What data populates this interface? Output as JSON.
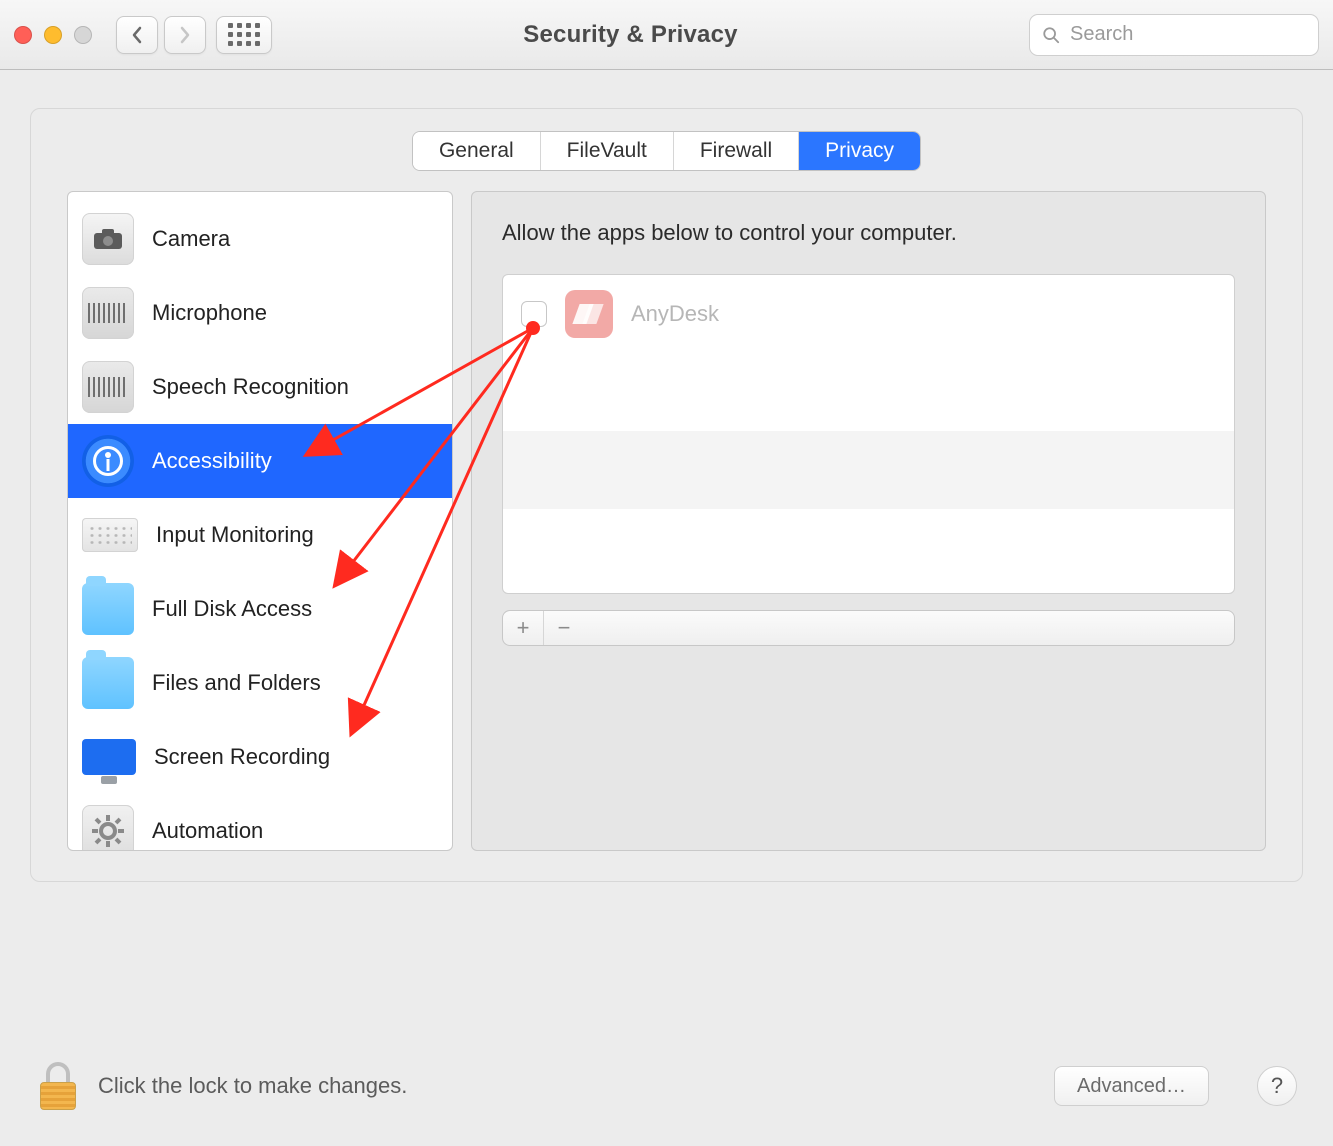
{
  "window": {
    "title": "Security & Privacy",
    "search_placeholder": "Search"
  },
  "tabs": [
    {
      "label": "General",
      "active": false
    },
    {
      "label": "FileVault",
      "active": false
    },
    {
      "label": "Firewall",
      "active": false
    },
    {
      "label": "Privacy",
      "active": true
    }
  ],
  "sidebar": {
    "items": [
      {
        "label": "Camera",
        "icon": "camera-icon"
      },
      {
        "label": "Microphone",
        "icon": "microphone-icon"
      },
      {
        "label": "Speech Recognition",
        "icon": "speech-icon"
      },
      {
        "label": "Accessibility",
        "icon": "accessibility-icon",
        "selected": true
      },
      {
        "label": "Input Monitoring",
        "icon": "keyboard-icon"
      },
      {
        "label": "Full Disk Access",
        "icon": "folder-icon"
      },
      {
        "label": "Files and Folders",
        "icon": "folder-icon"
      },
      {
        "label": "Screen Recording",
        "icon": "screen-icon"
      },
      {
        "label": "Automation",
        "icon": "gear-icon"
      }
    ]
  },
  "right": {
    "heading": "Allow the apps below to control your computer.",
    "apps": [
      {
        "name": "AnyDesk",
        "checked": false
      }
    ],
    "add_label": "+",
    "remove_label": "−"
  },
  "footer": {
    "lock_text": "Click the lock to make changes.",
    "advanced_label": "Advanced…",
    "help_label": "?"
  },
  "annotation": {
    "color": "#ff2a1f"
  }
}
